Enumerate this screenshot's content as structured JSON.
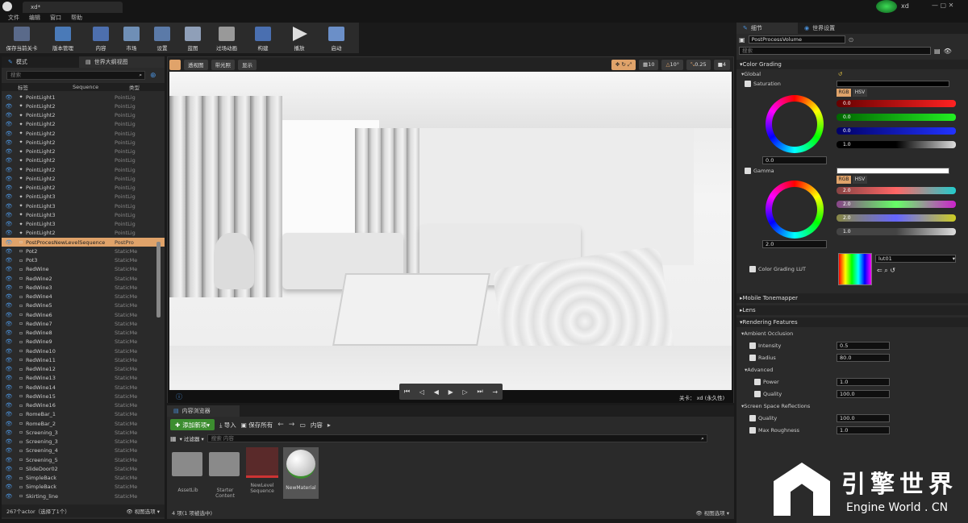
{
  "app": {
    "tab_title": "xd*",
    "user": "xd"
  },
  "menu": [
    "文件",
    "编辑",
    "窗口",
    "帮助"
  ],
  "toolbar": [
    {
      "label": "保存当前关卡",
      "icon": "save-icon"
    },
    {
      "label": "版本管理",
      "icon": "source-control-icon"
    },
    {
      "label": "内容",
      "icon": "content-icon"
    },
    {
      "label": "市场",
      "icon": "marketplace-icon"
    },
    {
      "label": "设置",
      "icon": "settings-icon"
    },
    {
      "label": "蓝图",
      "icon": "blueprint-icon"
    },
    {
      "label": "过场动画",
      "icon": "cinematics-icon"
    },
    {
      "label": "构建",
      "icon": "build-icon"
    },
    {
      "label": "播放",
      "icon": "play-icon"
    },
    {
      "label": "启动",
      "icon": "launch-icon"
    }
  ],
  "left": {
    "tabs": [
      "模式",
      "世界大纲视图"
    ],
    "search_placeholder": "搜索",
    "col_label": "标签",
    "col_seq": "Sequence",
    "col_type": "类型",
    "rows": [
      {
        "name": "PointLight1",
        "type": "PointLig"
      },
      {
        "name": "PointLight2",
        "type": "PointLig"
      },
      {
        "name": "PointLight2",
        "type": "PointLig"
      },
      {
        "name": "PointLight2",
        "type": "PointLig"
      },
      {
        "name": "PointLight2",
        "type": "PointLig"
      },
      {
        "name": "PointLight2",
        "type": "PointLig"
      },
      {
        "name": "PointLight2",
        "type": "PointLig"
      },
      {
        "name": "PointLight2",
        "type": "PointLig"
      },
      {
        "name": "PointLight2",
        "type": "PointLig"
      },
      {
        "name": "PointLight2",
        "type": "PointLig"
      },
      {
        "name": "PointLight2",
        "type": "PointLig"
      },
      {
        "name": "PointLight3",
        "type": "PointLig"
      },
      {
        "name": "PointLight3",
        "type": "PointLig"
      },
      {
        "name": "PointLight3",
        "type": "PointLig"
      },
      {
        "name": "PointLight3",
        "type": "PointLig"
      },
      {
        "name": "PointLight2",
        "type": "PointLig"
      },
      {
        "name": "PostProcesNewLevelSequence",
        "type": "PostPro",
        "sel": true
      },
      {
        "name": "Pot2",
        "type": "StaticMe"
      },
      {
        "name": "Pot3",
        "type": "StaticMe"
      },
      {
        "name": "RedWine",
        "type": "StaticMe"
      },
      {
        "name": "RedWine2",
        "type": "StaticMe"
      },
      {
        "name": "RedWine3",
        "type": "StaticMe"
      },
      {
        "name": "RedWine4",
        "type": "StaticMe"
      },
      {
        "name": "RedWine5",
        "type": "StaticMe"
      },
      {
        "name": "RedWine6",
        "type": "StaticMe"
      },
      {
        "name": "RedWine7",
        "type": "StaticMe"
      },
      {
        "name": "RedWine8",
        "type": "StaticMe"
      },
      {
        "name": "RedWine9",
        "type": "StaticMe"
      },
      {
        "name": "RedWine10",
        "type": "StaticMe"
      },
      {
        "name": "RedWine11",
        "type": "StaticMe"
      },
      {
        "name": "RedWine12",
        "type": "StaticMe"
      },
      {
        "name": "RedWine13",
        "type": "StaticMe"
      },
      {
        "name": "RedWine14",
        "type": "StaticMe"
      },
      {
        "name": "RedWine15",
        "type": "StaticMe"
      },
      {
        "name": "RedWine16",
        "type": "StaticMe"
      },
      {
        "name": "RomeBar_1",
        "type": "StaticMe"
      },
      {
        "name": "RomeBar_2",
        "type": "StaticMe"
      },
      {
        "name": "Screening_3",
        "type": "StaticMe"
      },
      {
        "name": "Screening_3",
        "type": "StaticMe"
      },
      {
        "name": "Screening_4",
        "type": "StaticMe"
      },
      {
        "name": "Screening_5",
        "type": "StaticMe"
      },
      {
        "name": "SlideDoor02",
        "type": "StaticMe"
      },
      {
        "name": "SimpleBack",
        "type": "StaticMe"
      },
      {
        "name": "SimpleBack",
        "type": "StaticMe"
      },
      {
        "name": "Skirting_line",
        "type": "StaticMe"
      }
    ],
    "footer": "267个actor（选择了1个）",
    "view_options": "视图选项"
  },
  "viewport": {
    "perspective": "透视图",
    "lit": "带光照",
    "show": "显示",
    "grid": "10",
    "angle": "10°",
    "scale": "0.25",
    "speed": "4",
    "level": "关卡：",
    "level_name": "xd (永久性)"
  },
  "content": {
    "tab": "内容浏览器",
    "add_new": "添加新项",
    "import": "导入",
    "save_all": "保存所有",
    "path": "内容",
    "filters": "过滤器",
    "search_placeholder": "搜索 内容",
    "assets": [
      {
        "label": "AssetLib",
        "kind": "folder"
      },
      {
        "label": "Starter Content",
        "kind": "folder"
      },
      {
        "label": "NewLevel Sequence",
        "kind": "sequence"
      },
      {
        "label": "NewMaterial",
        "kind": "material"
      }
    ],
    "footer": "4 项(1 项被选中)",
    "view_options": "视图选项"
  },
  "details": {
    "tabs": [
      "细节",
      "世界设置"
    ],
    "object_name": "PostProcessVolume",
    "search_placeholder": "搜索",
    "color_grading": "Color Grading",
    "global": "Global",
    "saturation": "Saturation",
    "saturation_value": "0.0",
    "gamma": "Gamma",
    "gamma_value": "2.0",
    "rgb": "RGB",
    "hsv": "HSV",
    "sat_channels": [
      {
        "k": "R",
        "v": "0.0"
      },
      {
        "k": "G",
        "v": "0.0"
      },
      {
        "k": "B",
        "v": "0.0"
      },
      {
        "k": "Y",
        "v": "1.0"
      }
    ],
    "gam_channels": [
      {
        "k": "R",
        "v": "2.0"
      },
      {
        "k": "G",
        "v": "2.0"
      },
      {
        "k": "B",
        "v": "2.0"
      },
      {
        "k": "Y",
        "v": "1.0"
      }
    ],
    "lut_label": "Color Grading LUT",
    "lut_value": "lut01",
    "mobile_tonemapper": "Mobile Tonemapper",
    "lens": "Lens",
    "rendering_features": "Rendering Features",
    "ambient_occlusion": "Ambient Occlusion",
    "intensity": "Intensity",
    "intensity_value": "0.5",
    "radius": "Radius",
    "radius_value": "80.0",
    "advanced": "Advanced",
    "power": "Power",
    "power_value": "1.0",
    "quality": "Quality",
    "quality_value": "100.0",
    "ssr": "Screen Space Reflections",
    "ssr_quality": "Quality",
    "ssr_quality_value": "100.0",
    "max_roughness": "Max Roughness",
    "max_roughness_value": "1.0"
  },
  "watermark": {
    "cn": "引擎世界",
    "en": "Engine World . CN"
  },
  "colors": {
    "accent": "#e0a36a",
    "add_green": "#3c8d2f",
    "bg": "#2a2a2a"
  }
}
